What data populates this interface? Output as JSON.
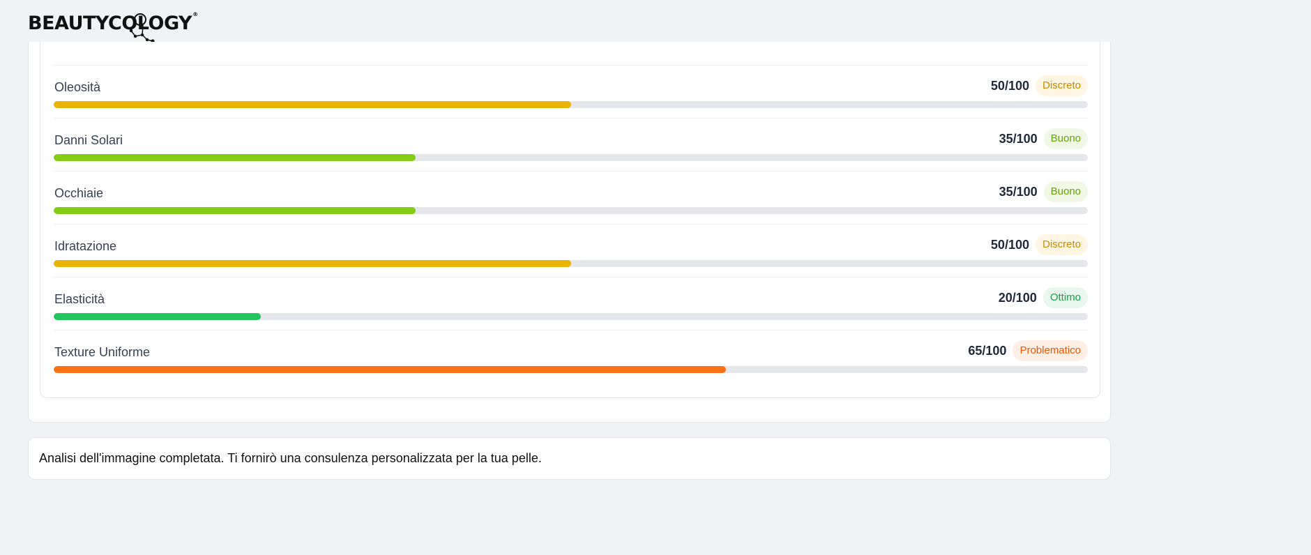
{
  "header": {
    "logo_text": "BEAUTYCOLOGY"
  },
  "metrics": [
    {
      "label": "Oleosità",
      "score": "50/100",
      "value": 50,
      "status": "Discreto",
      "color": "#eab308"
    },
    {
      "label": "Danni Solari",
      "score": "35/100",
      "value": 35,
      "status": "Buono",
      "color": "#84cc16"
    },
    {
      "label": "Occhiaie",
      "score": "35/100",
      "value": 35,
      "status": "Buono",
      "color": "#84cc16"
    },
    {
      "label": "Idratazione",
      "score": "50/100",
      "value": 50,
      "status": "Discreto",
      "color": "#eab308"
    },
    {
      "label": "Elasticità",
      "score": "20/100",
      "value": 20,
      "status": "Ottimo",
      "color": "#22c55e"
    },
    {
      "label": "Texture Uniforme",
      "score": "65/100",
      "value": 65,
      "status": "Problematico",
      "color": "#f97316"
    }
  ],
  "message": {
    "text": "Analisi dell'immagine completata. Ti fornirò una consulenza personalizzata per la tua pelle."
  }
}
